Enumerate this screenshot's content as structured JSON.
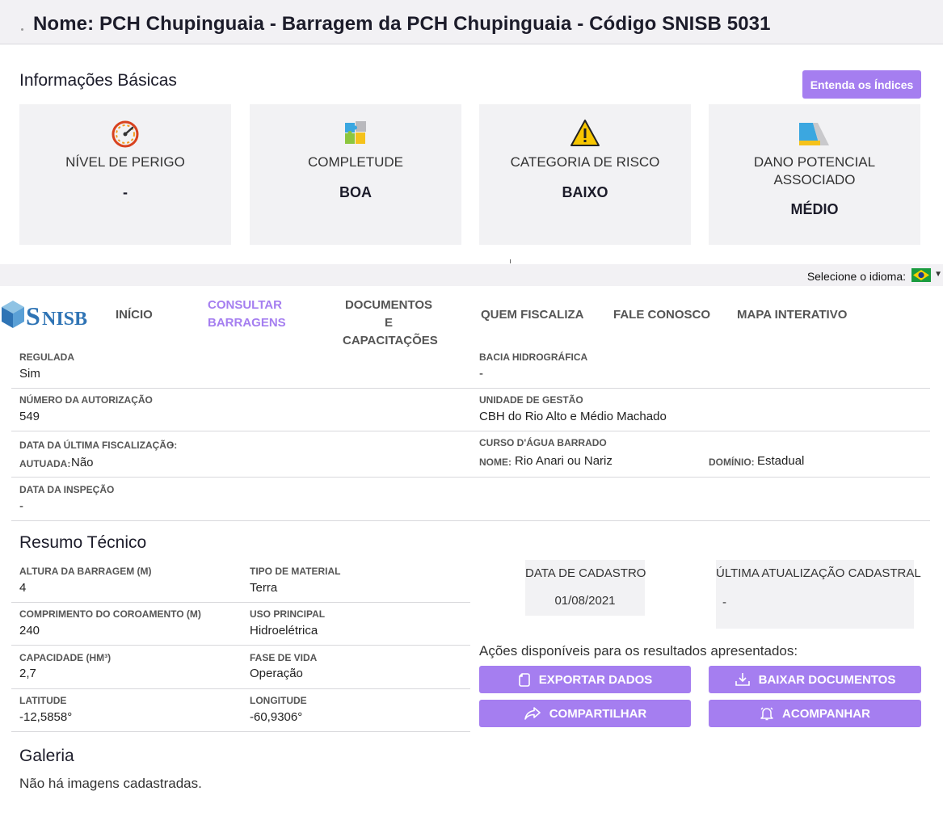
{
  "header": {
    "title": "Nome: PCH Chupinguaia - Barragem da PCH Chupinguaia - Código SNISB 5031"
  },
  "basic_info": {
    "title": "Informações Básicas",
    "button_label": "Entenda os Índices",
    "cards": [
      {
        "label": "NÍVEL DE PERIGO",
        "value": "-",
        "icon": "speedometer-icon"
      },
      {
        "label": "COMPLETUDE",
        "value": "BOA",
        "icon": "puzzle-icon"
      },
      {
        "label": "CATEGORIA DE RISCO",
        "value": "BAIXO",
        "icon": "warning-icon"
      },
      {
        "label": "DANO POTENCIAL ASSOCIADO",
        "value": "MÉDIO",
        "icon": "dam-icon"
      }
    ]
  },
  "language": {
    "label": "Selecione o idioma:"
  },
  "nav": {
    "logo_text": "SNISB",
    "items": [
      {
        "label": "INÍCIO"
      },
      {
        "label": "CONSULTAR\nBARRAGENS",
        "active": true
      },
      {
        "label": "DOCUMENTOS E\nCAPACITAÇÕES"
      },
      {
        "label": "QUEM FISCALIZA"
      },
      {
        "label": "FALE CONOSCO"
      },
      {
        "label": "MAPA INTERATIVO"
      }
    ]
  },
  "details": {
    "regulada": {
      "label": "REGULADA",
      "value": "Sim"
    },
    "bacia": {
      "label": "BACIA HIDROGRÁFICA",
      "value": "-"
    },
    "autorizacao": {
      "label": "NÚMERO DA AUTORIZAÇÃO",
      "value": "549"
    },
    "unidade": {
      "label": "UNIDADE DE GESTÃO",
      "value": "CBH do Rio Alto e Médio Machado"
    },
    "fiscalizacao": {
      "label": "DATA DA ÚLTIMA FISCALIZAÇÃO:",
      "value": "-"
    },
    "autuada": {
      "label": "AUTUADA:",
      "value": "Não"
    },
    "curso": {
      "label": "CURSO D'ÁGUA BARRADO"
    },
    "nome": {
      "label": "NOME:",
      "value": "Rio Anari ou Nariz"
    },
    "dominio": {
      "label": "DOMÍNIO:",
      "value": "Estadual"
    },
    "inspecao": {
      "label": "DATA DA INSPEÇÃO",
      "value": "-"
    }
  },
  "resumo": {
    "title": "Resumo Técnico",
    "altura": {
      "label": "ALTURA DA BARRAGEM (m)",
      "value": "4"
    },
    "material": {
      "label": "TIPO DE MATERIAL",
      "value": "Terra"
    },
    "comprimento": {
      "label": "COMPRIMENTO DO COROAMENTO (m)",
      "value": "240"
    },
    "uso": {
      "label": "USO PRINCIPAL",
      "value": "Hidroelétrica"
    },
    "capacidade": {
      "label": "CAPACIDADE (hm³)",
      "value": "2,7"
    },
    "fase": {
      "label": "FASE DE VIDA",
      "value": "Operação"
    },
    "latitude": {
      "label": "LATITUDE",
      "value": "-12,5858°"
    },
    "longitude": {
      "label": "LONGITUDE",
      "value": "-60,9306°"
    }
  },
  "cadastro": {
    "data_label": "DATA DE CADASTRO",
    "data_value": "01/08/2021",
    "atualizacao_label": "ÚLTIMA ATUALIZAÇÃO CADASTRAL",
    "atualizacao_value": "-"
  },
  "actions": {
    "text": "Ações disponíveis para os resultados apresentados:",
    "export": "EXPORTAR DADOS",
    "download": "BAIXAR DOCUMENTOS",
    "share": "COMPARTILHAR",
    "follow": "ACOMPANHAR"
  },
  "gallery": {
    "title": "Galeria",
    "text": "Não há imagens cadastradas."
  },
  "colors": {
    "accent": "#a57ef0",
    "card_bg": "#f2f2f4"
  }
}
